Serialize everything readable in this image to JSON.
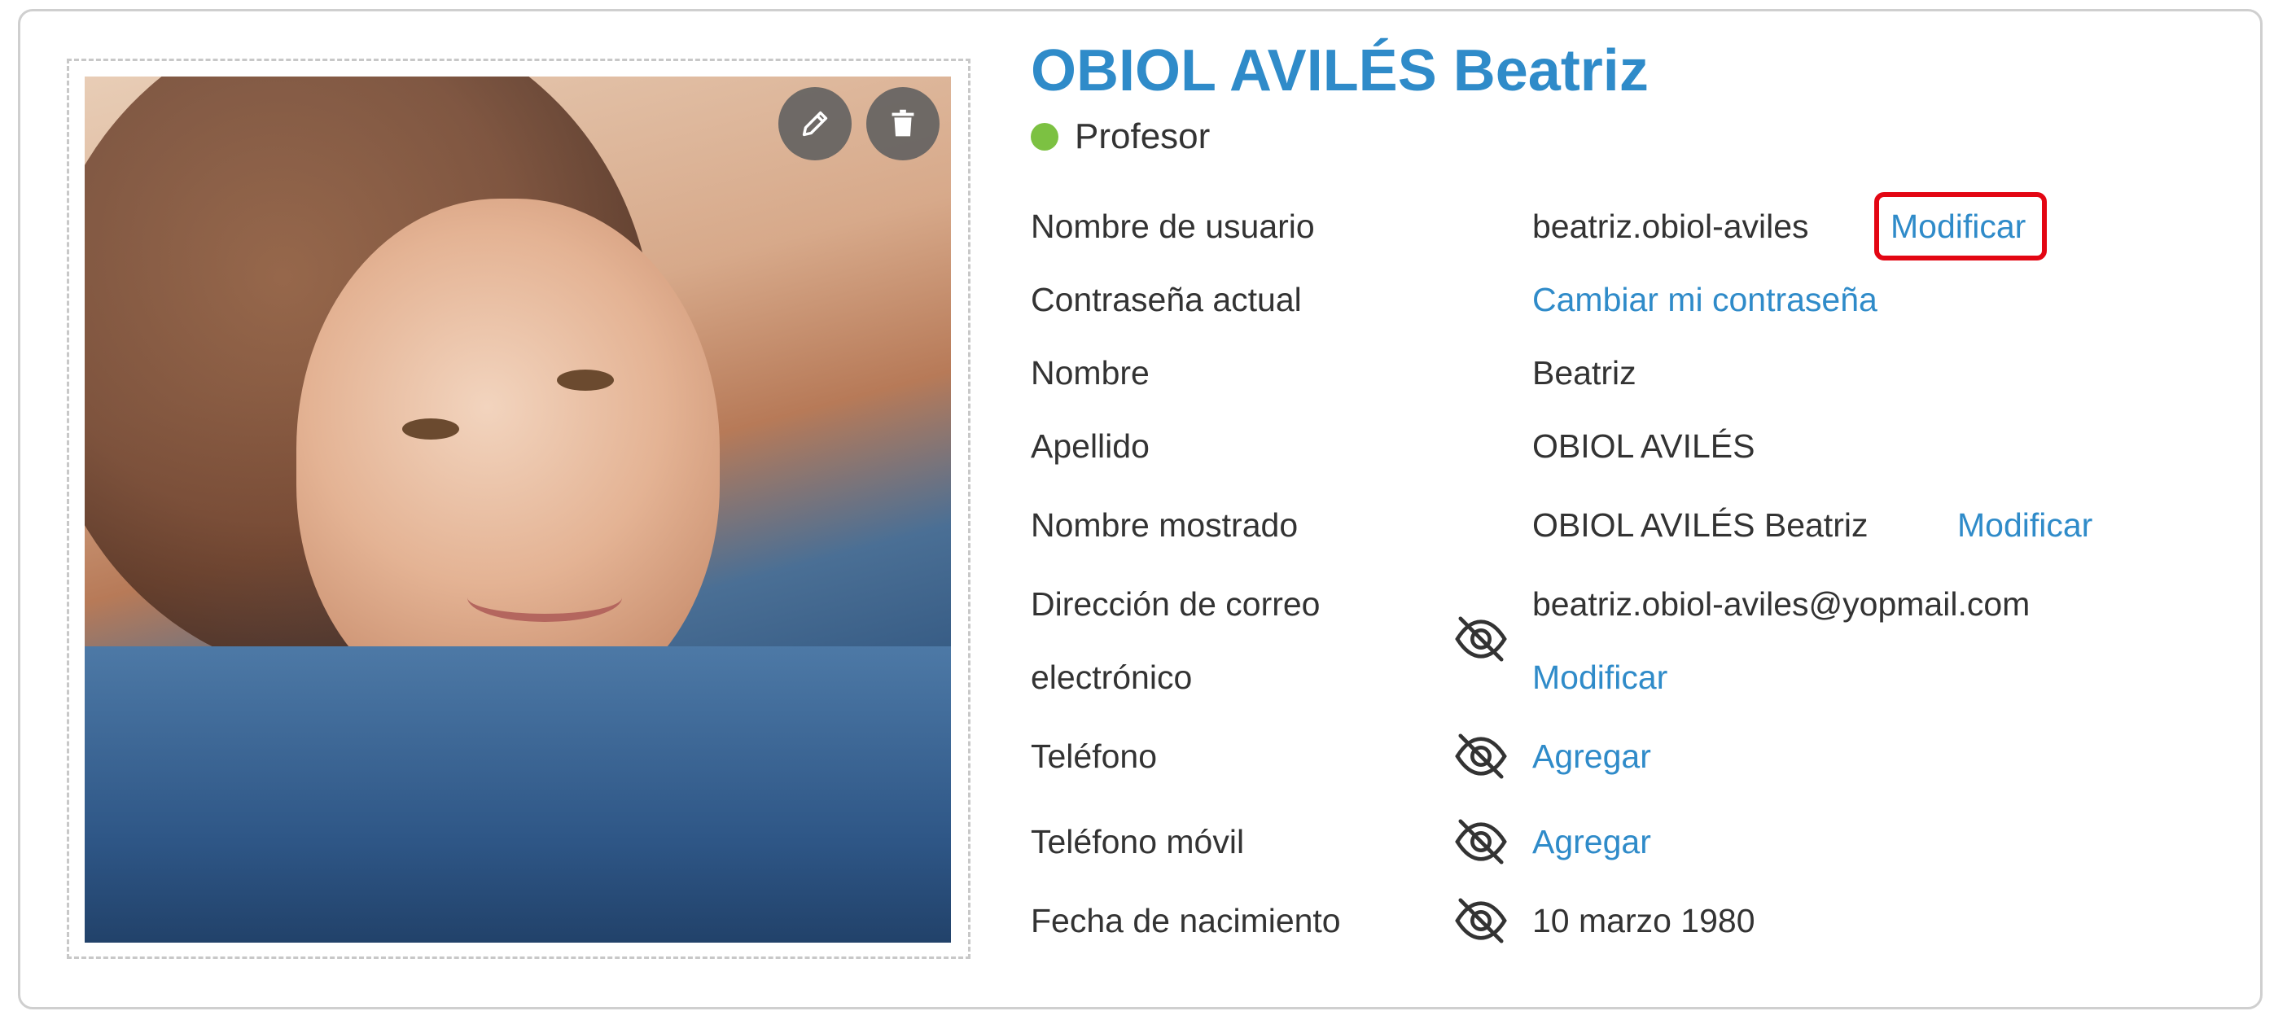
{
  "profile": {
    "display_name": "OBIOL AVILÉS Beatriz",
    "role": "Profesor",
    "status_color": "#7cc142",
    "accent_color": "#2f8bc9"
  },
  "photo_actions": {
    "edit_icon": "pencil-icon",
    "delete_icon": "trash-icon"
  },
  "fields": {
    "username": {
      "label": "Nombre de usuario",
      "value": "beatriz.obiol-aviles",
      "action": "Modificar"
    },
    "password": {
      "label": "Contraseña actual",
      "action": "Cambiar mi contraseña"
    },
    "first_name": {
      "label": "Nombre",
      "value": "Beatriz"
    },
    "last_name": {
      "label": "Apellido",
      "value": "OBIOL AVILÉS"
    },
    "display_name": {
      "label": "Nombre mostrado",
      "value": "OBIOL AVILÉS Beatriz",
      "action": "Modificar"
    },
    "email": {
      "label_line1": "Dirección de correo",
      "label_line2": "electrónico",
      "value": "beatriz.obiol-aviles@yopmail.com",
      "action": "Modificar",
      "visibility_icon": "eye-off-icon"
    },
    "phone": {
      "label": "Teléfono",
      "action": "Agregar",
      "visibility_icon": "eye-off-icon"
    },
    "mobile": {
      "label": "Teléfono móvil",
      "action": "Agregar",
      "visibility_icon": "eye-off-icon"
    },
    "birthdate": {
      "label": "Fecha de nacimiento",
      "value": "10 marzo 1980",
      "visibility_icon": "eye-off-icon"
    }
  }
}
